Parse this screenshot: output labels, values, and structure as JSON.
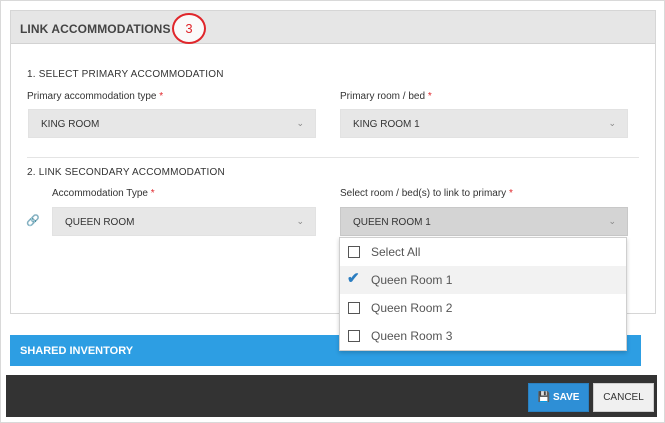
{
  "panel": {
    "title": "LINK ACCOMMODATIONS",
    "step_number": "3"
  },
  "section1": {
    "heading": "1. SELECT PRIMARY ACCOMMODATION",
    "type_label": "Primary accommodation type",
    "type_value": "KING ROOM",
    "room_label": "Primary room / bed",
    "room_value": "KING ROOM 1"
  },
  "section2": {
    "heading": "2. LINK SECONDARY ACCOMMODATION",
    "type_label": "Accommodation Type",
    "type_value": "QUEEN ROOM",
    "room_label": "Select room / bed(s) to link to primary",
    "room_value": "QUEEN ROOM 1"
  },
  "required_marker": "*",
  "dropdown": {
    "options": [
      {
        "label": "Select All",
        "checked": false
      },
      {
        "label": "Queen Room 1",
        "checked": true
      },
      {
        "label": "Queen Room 2",
        "checked": false
      },
      {
        "label": "Queen Room 3",
        "checked": false
      }
    ]
  },
  "shared_inventory": {
    "label": "SHARED INVENTORY"
  },
  "footer": {
    "save_label": "SAVE",
    "cancel_label": "CANCEL"
  },
  "icons": {
    "chevron": "chevron-down-icon",
    "link": "link-icon",
    "save": "floppy-disk-icon",
    "check": "checkmark-icon"
  },
  "colors": {
    "accent_blue": "#2d9ee3",
    "required_red": "#e0262b",
    "footer_dark": "#333333"
  }
}
